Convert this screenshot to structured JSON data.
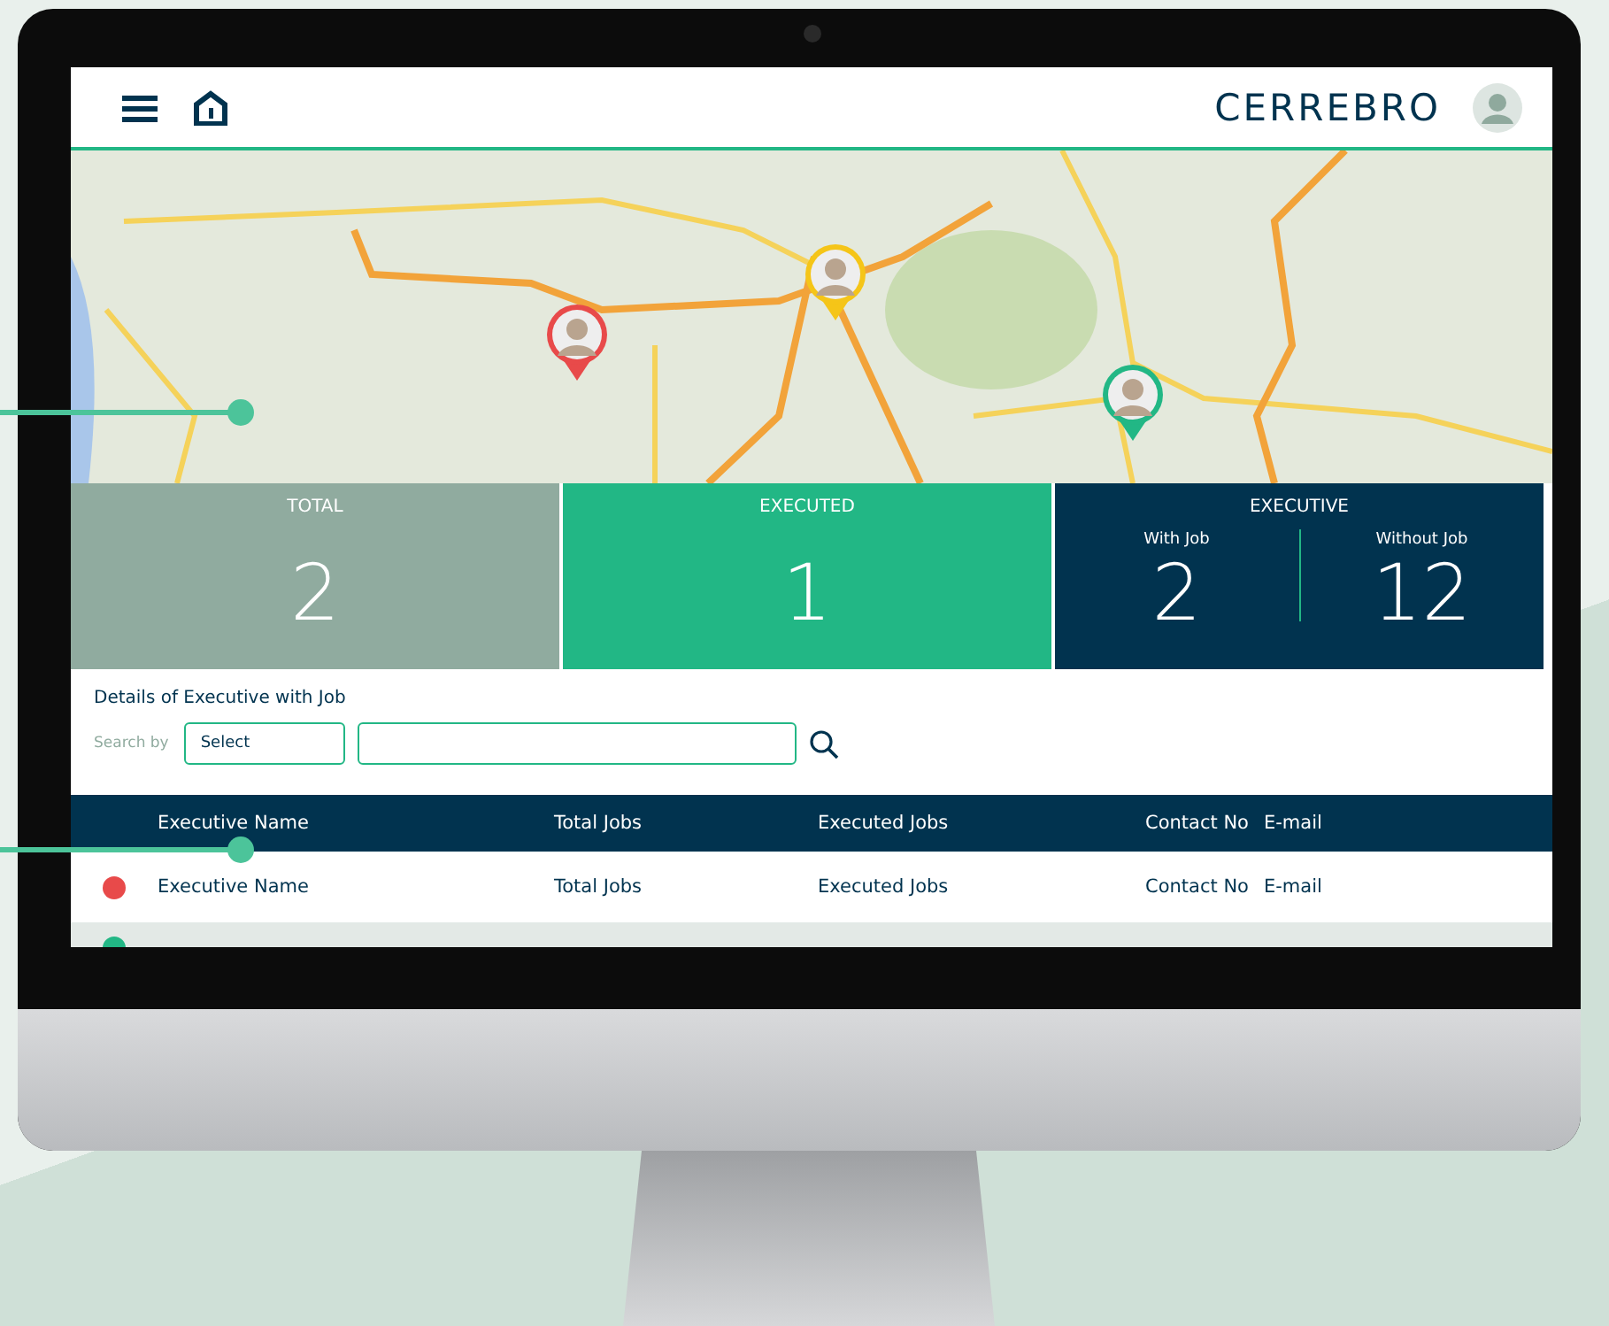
{
  "header": {
    "logo": "CERREBRO"
  },
  "map": {
    "markers": [
      {
        "color": "#e84a4a"
      },
      {
        "color": "#f5c518"
      },
      {
        "color": "#22b785"
      }
    ]
  },
  "stats": [
    {
      "kind": "single",
      "label": "TOTAL",
      "value": "2"
    },
    {
      "kind": "single",
      "label": "EXECUTED",
      "value": "1"
    },
    {
      "kind": "split",
      "label": "EXECUTIVE",
      "parts": [
        {
          "label": "With Job",
          "value": "2"
        },
        {
          "label": "Without Job",
          "value": "12"
        }
      ]
    }
  ],
  "details": {
    "title": "Details of Executive with Job",
    "search_label": "Search by",
    "select": {
      "value": "Select"
    }
  },
  "table": {
    "columns": [
      "Executive Name",
      "Total Jobs",
      "Executed Jobs",
      "Contact No",
      "E-mail"
    ],
    "rows": [
      {
        "color": "#e84a4a",
        "cells": [
          "Executive Name",
          "Total Jobs",
          "Executed Jobs",
          "Contact No",
          "E-mail"
        ]
      },
      {
        "color": "#22b785",
        "cells": []
      }
    ]
  }
}
